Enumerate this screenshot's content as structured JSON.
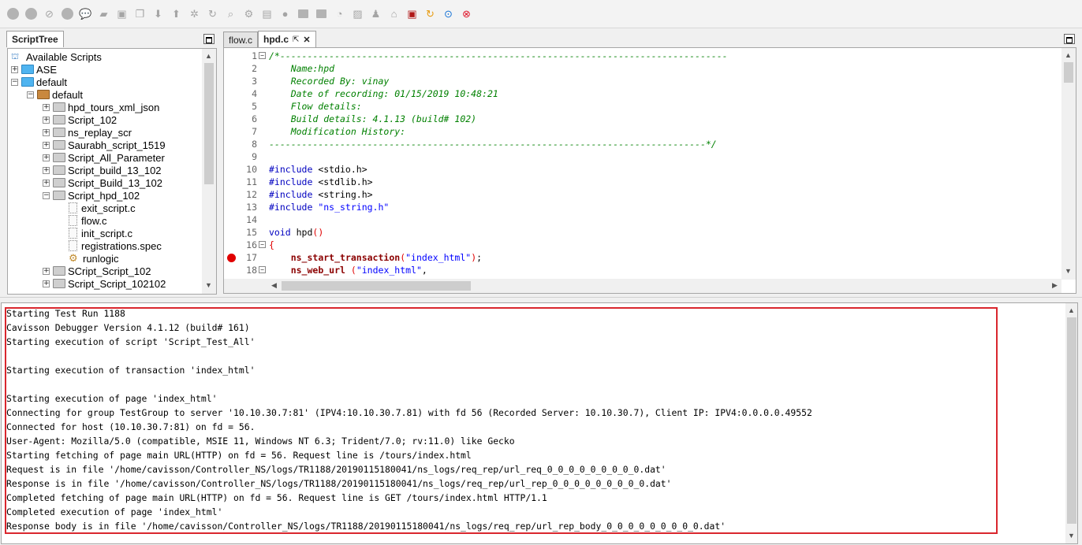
{
  "toolbar": {
    "icons": [
      "record-icon",
      "stop-icon",
      "block-icon",
      "pause-icon",
      "comment-icon",
      "new-page-icon",
      "save-icon",
      "copy-icon",
      "download-icon",
      "upload-icon",
      "settings-icon",
      "refresh-icon",
      "search-icon",
      "gear-icon",
      "page-icon",
      "dot-icon",
      "rect-icon",
      "screen-icon",
      "clock-icon",
      "image-icon",
      "user-icon",
      "home-icon",
      "save-red-icon",
      "redo-icon",
      "next-icon",
      "stop-red-icon"
    ]
  },
  "scripttree": {
    "tab_label": "ScriptTree",
    "rows": [
      {
        "label": "Available Scripts",
        "type": "root"
      },
      {
        "label": "ASE",
        "type": "folder-blue",
        "exp": "+"
      },
      {
        "label": "default",
        "type": "folder-blue",
        "exp": "−"
      },
      {
        "label": "default",
        "type": "folder-brown",
        "exp": "−"
      },
      {
        "label": "hpd_tours_xml_json",
        "type": "folder",
        "exp": "+"
      },
      {
        "label": "Script_102",
        "type": "folder",
        "exp": "+"
      },
      {
        "label": "ns_replay_scr",
        "type": "folder",
        "exp": "+"
      },
      {
        "label": "Saurabh_script_1519",
        "type": "folder",
        "exp": "+"
      },
      {
        "label": "Script_All_Parameter",
        "type": "folder",
        "exp": "+"
      },
      {
        "label": "Script_build_13_102",
        "type": "folder",
        "exp": "+"
      },
      {
        "label": "Script_Build_13_102",
        "type": "folder",
        "exp": "+"
      },
      {
        "label": "Script_hpd_102",
        "type": "folder",
        "exp": "−"
      },
      {
        "label": "exit_script.c",
        "type": "file"
      },
      {
        "label": "flow.c",
        "type": "file"
      },
      {
        "label": "init_script.c",
        "type": "file"
      },
      {
        "label": "registrations.spec",
        "type": "file"
      },
      {
        "label": "runlogic",
        "type": "gear"
      },
      {
        "label": "SCript_Script_102",
        "type": "folder",
        "exp": "+"
      },
      {
        "label": "Script_Script_102102",
        "type": "folder",
        "exp": "+"
      }
    ]
  },
  "editor": {
    "tabs": [
      {
        "label": "flow.c",
        "active": false
      },
      {
        "label": "hpd.c",
        "active": true
      }
    ],
    "lines": [
      {
        "n": "1",
        "fold": "−",
        "parts": [
          [
            "cm",
            "/*----------------------------------------------------------------------------------"
          ]
        ]
      },
      {
        "n": "2",
        "parts": [
          [
            "cm",
            "    Name:hpd"
          ]
        ]
      },
      {
        "n": "3",
        "parts": [
          [
            "cm",
            "    Recorded By: vinay"
          ]
        ]
      },
      {
        "n": "4",
        "parts": [
          [
            "cm",
            "    Date of recording: 01/15/2019 10:48:21"
          ]
        ]
      },
      {
        "n": "5",
        "parts": [
          [
            "cm",
            "    Flow details:"
          ]
        ]
      },
      {
        "n": "6",
        "parts": [
          [
            "cm",
            "    Build details: 4.1.13 (build# 102)"
          ]
        ]
      },
      {
        "n": "7",
        "parts": [
          [
            "cm",
            "    Modification History:"
          ]
        ]
      },
      {
        "n": "8",
        "parts": [
          [
            "cm",
            "--------------------------------------------------------------------------------*/"
          ]
        ]
      },
      {
        "n": "9",
        "parts": []
      },
      {
        "n": "10",
        "parts": [
          [
            "kw",
            "#include "
          ],
          [
            "pl",
            "<stdio.h>"
          ]
        ]
      },
      {
        "n": "11",
        "parts": [
          [
            "kw",
            "#include "
          ],
          [
            "pl",
            "<stdlib.h>"
          ]
        ]
      },
      {
        "n": "12",
        "parts": [
          [
            "kw",
            "#include "
          ],
          [
            "pl",
            "<string.h>"
          ]
        ]
      },
      {
        "n": "13",
        "parts": [
          [
            "kw",
            "#include "
          ],
          [
            "str",
            "\"ns_string.h\""
          ]
        ]
      },
      {
        "n": "14",
        "parts": []
      },
      {
        "n": "15",
        "parts": [
          [
            "kw",
            "void "
          ],
          [
            "pl",
            "hpd"
          ],
          [
            "rd",
            "()"
          ]
        ]
      },
      {
        "n": "16",
        "fold": "−",
        "parts": [
          [
            "rd",
            "{"
          ]
        ]
      },
      {
        "n": "17",
        "breakpoint": true,
        "parts": [
          [
            "pl",
            "    "
          ],
          [
            "fn",
            "ns_start_transaction"
          ],
          [
            "rd",
            "("
          ],
          [
            "str",
            "\"index_html\""
          ],
          [
            "rd",
            ")"
          ],
          [
            "pl",
            ";"
          ]
        ]
      },
      {
        "n": "18",
        "fold": "−",
        "parts": [
          [
            "pl",
            "    "
          ],
          [
            "fn",
            "ns_web_url"
          ],
          [
            "pl",
            " "
          ],
          [
            "rd",
            "("
          ],
          [
            "str",
            "\"index_html\""
          ],
          [
            "pl",
            ","
          ]
        ]
      }
    ]
  },
  "console": {
    "lines": [
      "Starting Test Run 1188",
      "Cavisson Debugger Version 4.1.12 (build# 161)",
      "Starting execution of script 'Script_Test_All'",
      "",
      "Starting execution of transaction 'index_html'",
      "",
      "Starting execution of page 'index_html'",
      "Connecting for group TestGroup to server '10.10.30.7:81' (IPV4:10.10.30.7.81) with fd 56 (Recorded Server: 10.10.30.7), Client IP: IPV4:0.0.0.0.49552",
      "Connected for host (10.10.30.7:81) on fd = 56.",
      "User-Agent: Mozilla/5.0 (compatible, MSIE 11, Windows NT 6.3; Trident/7.0; rv:11.0) like Gecko",
      "Starting fetching of page main URL(HTTP) on fd = 56. Request line is /tours/index.html",
      "Request is in file '/home/cavisson/Controller_NS/logs/TR1188/20190115180041/ns_logs/req_rep/url_req_0_0_0_0_0_0_0_0_0.dat'",
      "Response is in file '/home/cavisson/Controller_NS/logs/TR1188/20190115180041/ns_logs/req_rep/url_rep_0_0_0_0_0_0_0_0_0.dat'",
      "Completed fetching of page main URL(HTTP) on fd = 56. Request line is GET /tours/index.html HTTP/1.1",
      "Completed execution of page 'index_html'",
      "Response body is in file '/home/cavisson/Controller_NS/logs/TR1188/20190115180041/ns_logs/req_rep/url_rep_body_0_0_0_0_0_0_0_0_0.dat'"
    ]
  }
}
